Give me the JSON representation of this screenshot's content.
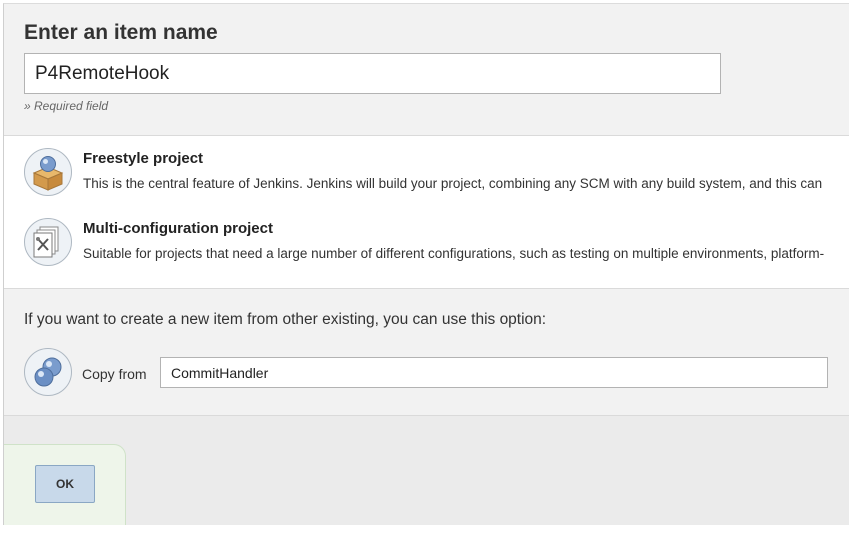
{
  "name_section": {
    "heading": "Enter an item name",
    "item_name_value": "P4RemoteHook",
    "required_note": "» Required field"
  },
  "item_types": [
    {
      "name": "Freestyle project",
      "description": "This is the central feature of Jenkins. Jenkins will build your project, combining any SCM with any build system, and this can",
      "icon": "box-with-ball-icon"
    },
    {
      "name": "Multi-configuration project",
      "description": "Suitable for projects that need a large number of different configurations, such as testing on multiple environments, platform-",
      "icon": "config-documents-icon"
    }
  ],
  "copy_section": {
    "intro": "If you want to create a new item from other existing, you can use this option:",
    "label": "Copy from",
    "value": "CommitHandler",
    "icon": "copy-spheres-icon"
  },
  "footer": {
    "ok_label": "OK"
  },
  "colors": {
    "section_bg": "#f2f2f2",
    "ok_button_bg": "#c8d9ea",
    "ok_panel_bg": "#eef5ea"
  }
}
